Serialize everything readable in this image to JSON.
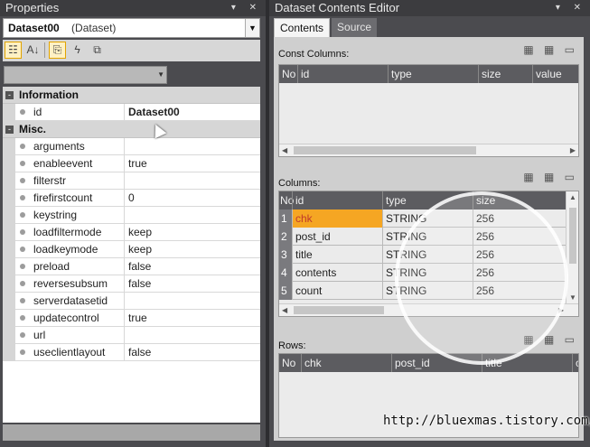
{
  "properties": {
    "title": "Properties",
    "title_controls": "▾ ✕",
    "object_name": "Dataset00",
    "object_type": "(Dataset)",
    "toolbar": [
      "categorized-icon",
      "alphabetical-icon",
      "properties-icon",
      "events-icon",
      "property-pages-icon"
    ],
    "groups": [
      {
        "name": "Information",
        "collapse": "-",
        "rows": [
          {
            "name": "id",
            "value": "Dataset00"
          }
        ]
      },
      {
        "name": "Misc.",
        "collapse": "-",
        "rows": [
          {
            "name": "arguments",
            "value": ""
          },
          {
            "name": "enableevent",
            "value": "true"
          },
          {
            "name": "filterstr",
            "value": ""
          },
          {
            "name": "firefirstcount",
            "value": "0"
          },
          {
            "name": "keystring",
            "value": ""
          },
          {
            "name": "loadfiltermode",
            "value": "keep"
          },
          {
            "name": "loadkeymode",
            "value": "keep"
          },
          {
            "name": "preload",
            "value": "false"
          },
          {
            "name": "reversesubsum",
            "value": "false"
          },
          {
            "name": "serverdatasetid",
            "value": ""
          },
          {
            "name": "updatecontrol",
            "value": "true"
          },
          {
            "name": "url",
            "value": ""
          },
          {
            "name": "useclientlayout",
            "value": "false"
          }
        ]
      }
    ]
  },
  "editor": {
    "title": "Dataset Contents Editor",
    "title_controls": "▾ ✕",
    "tabs": [
      "Contents",
      "Source"
    ],
    "const_columns": {
      "label": "Const Columns:",
      "headers": [
        "No",
        "id",
        "type",
        "size",
        "value"
      ]
    },
    "columns": {
      "label": "Columns:",
      "headers": [
        "No",
        "id",
        "type",
        "size"
      ],
      "rows": [
        {
          "no": "1",
          "id": "chk",
          "type": "STRING",
          "size": "256"
        },
        {
          "no": "2",
          "id": "post_id",
          "type": "STRING",
          "size": "256"
        },
        {
          "no": "3",
          "id": "title",
          "type": "STRING",
          "size": "256"
        },
        {
          "no": "4",
          "id": "contents",
          "type": "STRING",
          "size": "256"
        },
        {
          "no": "5",
          "id": "count",
          "type": "STRING",
          "size": "256"
        }
      ]
    },
    "rows_section": {
      "label": "Rows:",
      "headers": [
        "No",
        "chk",
        "post_id",
        "title",
        "c"
      ]
    },
    "section_icons": "▦ ▦ ▭"
  },
  "watermark": "http://bluexmas.tistory.com/"
}
